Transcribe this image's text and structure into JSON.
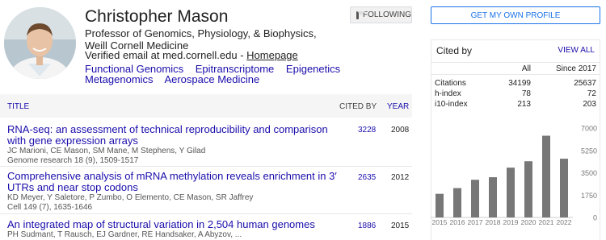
{
  "profile": {
    "name": "Christopher Mason",
    "affiliation": "Professor of Genomics, Physiology, & Biophysics, Weill Cornell Medicine",
    "email_text": "Verified email at med.cornell.edu - ",
    "homepage": "Homepage",
    "interests": [
      "Functional Genomics",
      "Epitranscriptome",
      "Epigenetics",
      "Metagenomics",
      "Aerospace Medicine"
    ],
    "follow_label": "FOLLOWING"
  },
  "table": {
    "col_title": "TITLE",
    "col_cited": "CITED BY",
    "col_year": "YEAR",
    "rows": [
      {
        "title": "RNA-seq: an assessment of technical reproducibility and comparison with gene expression arrays",
        "authors": "JC Marioni, CE Mason, SM Mane, M Stephens, Y Gilad",
        "venue": "Genome research 18 (9), 1509-1517",
        "cited": "3228",
        "year": "2008"
      },
      {
        "title": "Comprehensive analysis of mRNA methylation reveals enrichment in 3′ UTRs and near stop codons",
        "authors": "KD Meyer, Y Saletore, P Zumbo, O Elemento, CE Mason, SR Jaffrey",
        "venue": "Cell 149 (7), 1635-1646",
        "cited": "2635",
        "year": "2012"
      },
      {
        "title": "An integrated map of structural variation in 2,504 human genomes",
        "authors": "PH Sudmant, T Rausch, EJ Gardner, RE Handsaker, A Abyzov, ...",
        "venue": "",
        "cited": "1886",
        "year": "2015"
      }
    ]
  },
  "right": {
    "own_profile": "GET MY OWN PROFILE",
    "cited_by": "Cited by",
    "view_all": "VIEW ALL",
    "stats_header": [
      "",
      "All",
      "Since 2017"
    ],
    "stats": [
      [
        "Citations",
        "34199",
        "25637"
      ],
      [
        "h-index",
        "78",
        "72"
      ],
      [
        "i10-index",
        "213",
        "203"
      ]
    ]
  },
  "chart_data": {
    "type": "bar",
    "categories": [
      "2015",
      "2016",
      "2017",
      "2018",
      "2019",
      "2020",
      "2021",
      "2022"
    ],
    "values": [
      1850,
      2300,
      2950,
      3150,
      3900,
      4400,
      6400,
      4600
    ],
    "yticks": [
      0,
      1750,
      3500,
      5250,
      7000
    ],
    "ylim": [
      0,
      7000
    ],
    "bar_color": "#777777"
  },
  "colors": {
    "link": "#1a0dab",
    "accent": "#1a73e8"
  }
}
